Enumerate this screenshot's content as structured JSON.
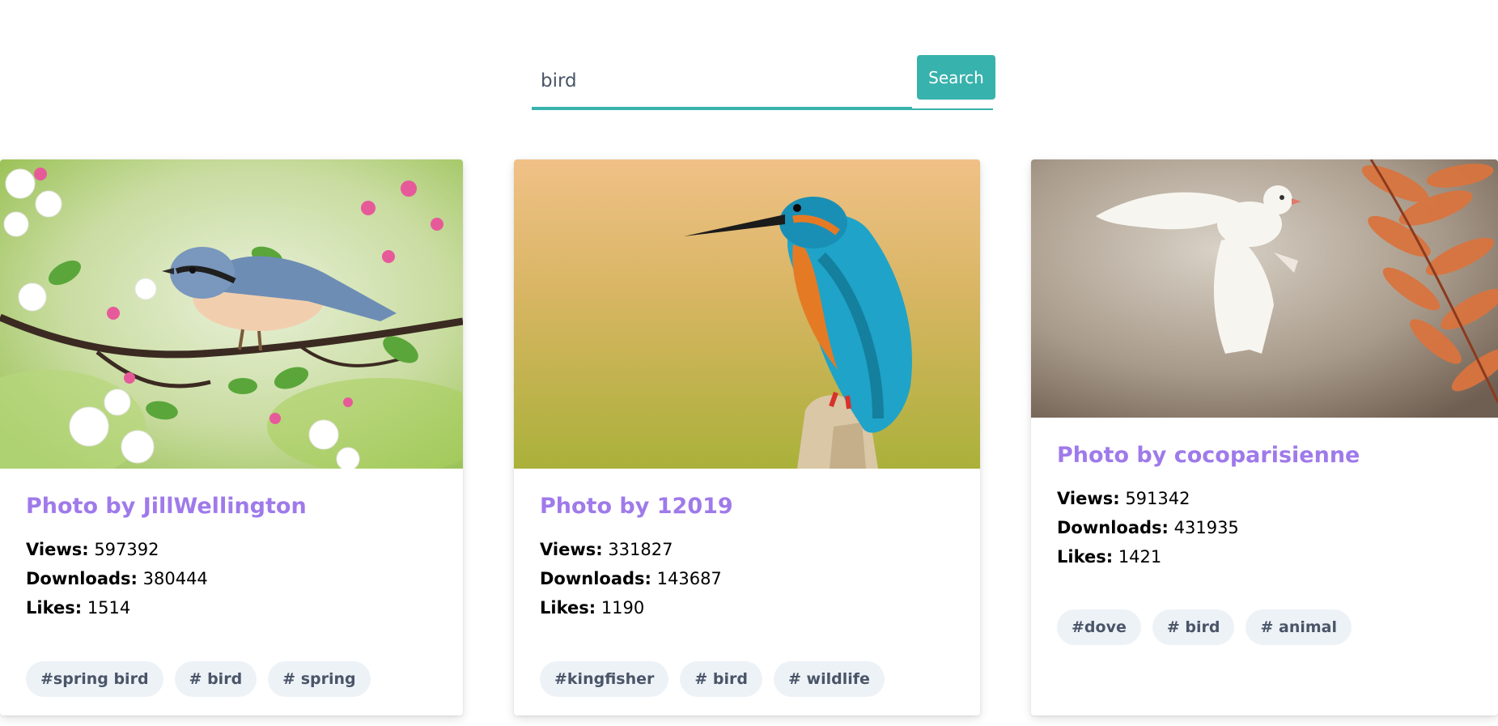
{
  "search": {
    "value": "bird",
    "button_label": "Search"
  },
  "colors": {
    "accent": "#38b2ac",
    "title": "#9f7aea",
    "tag_bg": "#edf2f7"
  },
  "cards": [
    {
      "title": "Photo by JillWellington",
      "views_label": "Views:",
      "views": "597392",
      "downloads_label": "Downloads:",
      "downloads": "380444",
      "likes_label": "Likes:",
      "likes": "1514",
      "tags": [
        "#spring bird",
        "# bird",
        "# spring"
      ],
      "photo": "nuthatch-on-blossom-branch"
    },
    {
      "title": "Photo by 12019",
      "views_label": "Views:",
      "views": "331827",
      "downloads_label": "Downloads:",
      "downloads": "143687",
      "likes_label": "Likes:",
      "likes": "1190",
      "tags": [
        "#kingfisher",
        "# bird",
        "# wildlife"
      ],
      "photo": "kingfisher-on-stump"
    },
    {
      "title": "Photo by cocoparisienne",
      "views_label": "Views:",
      "views": "591342",
      "downloads_label": "Downloads:",
      "downloads": "431935",
      "likes_label": "Likes:",
      "likes": "1421",
      "tags": [
        "#dove",
        "# bird",
        "# animal"
      ],
      "photo": "white-dove-flying"
    }
  ]
}
